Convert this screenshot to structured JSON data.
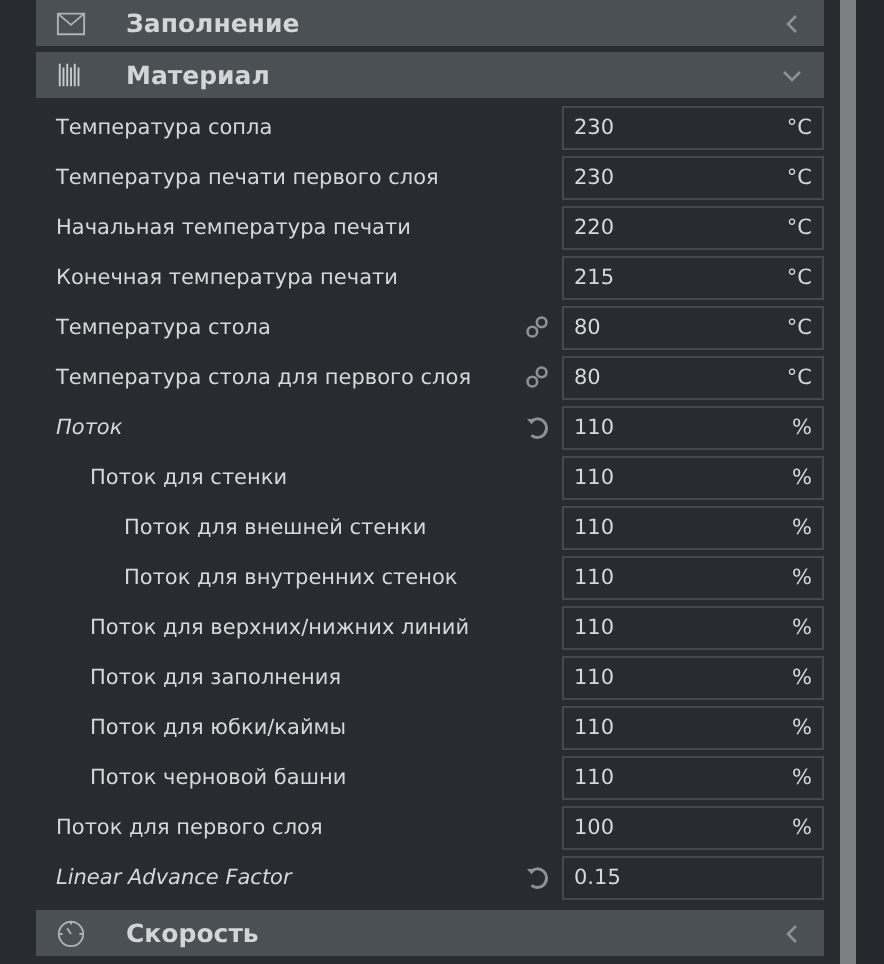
{
  "sections_above": [
    {
      "title": "Заполнение",
      "kind": "infill",
      "expanded": false
    }
  ],
  "material": {
    "title": "Материал",
    "kind": "material",
    "expanded": true,
    "settings": [
      {
        "label": "Температура сопла",
        "value": "230",
        "unit": "°C",
        "modified": false
      },
      {
        "label": "Температура печати первого слоя",
        "value": "230",
        "unit": "°C",
        "modified": false
      },
      {
        "label": "Начальная температура печати",
        "value": "220",
        "unit": "°C",
        "modified": false
      },
      {
        "label": "Конечная температура печати",
        "value": "215",
        "unit": "°C",
        "modified": false
      },
      {
        "label": "Температура стола",
        "value": "80",
        "unit": "°C",
        "modified": false,
        "kind": "linked"
      },
      {
        "label": "Температура стола для первого слоя",
        "value": "80",
        "unit": "°C",
        "modified": false,
        "kind": "linked"
      },
      {
        "label": "Поток",
        "value": "110",
        "unit": "%",
        "modified": true,
        "kind": "resettable",
        "children": [
          {
            "label": "Поток для стенки",
            "value": "110",
            "unit": "%",
            "modified": false,
            "children": [
              {
                "label": "Поток для внешней стенки",
                "value": "110",
                "unit": "%",
                "modified": false
              },
              {
                "label": "Поток для внутренних стенок",
                "value": "110",
                "unit": "%",
                "modified": false
              }
            ]
          },
          {
            "label": "Поток для верхних/нижних линий",
            "value": "110",
            "unit": "%",
            "modified": false
          },
          {
            "label": "Поток для заполнения",
            "value": "110",
            "unit": "%",
            "modified": false
          },
          {
            "label": "Поток для юбки/каймы",
            "value": "110",
            "unit": "%",
            "modified": false
          },
          {
            "label": "Поток черновой башни",
            "value": "110",
            "unit": "%",
            "modified": false
          }
        ]
      },
      {
        "label": "Поток для первого слоя",
        "value": "100",
        "unit": "%",
        "modified": false
      },
      {
        "label": "Linear Advance Factor",
        "value": "0.15",
        "modified": true,
        "kind": "resettable"
      }
    ]
  },
  "sections_below": [
    {
      "title": "Скорость",
      "kind": "speed",
      "expanded": false
    }
  ]
}
